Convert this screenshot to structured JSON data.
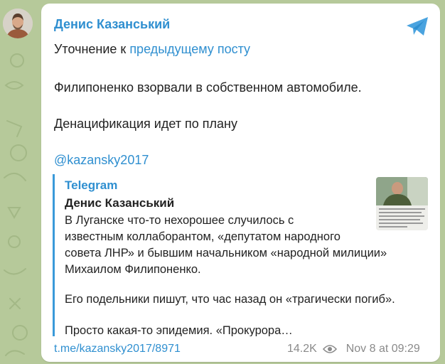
{
  "channel": {
    "author": "Денис Казанський",
    "avatar_icon": "user-photo-avatar",
    "share_icon": "telegram-share-icon"
  },
  "message": {
    "line1_text": "Уточнение к ",
    "line1_link": "предыдущему посту",
    "line2": "Филипоненко взорвали в собственном автомобиле.",
    "line3": "Денацификация идет по плану",
    "mention": "@kazansky2017"
  },
  "quote": {
    "source": "Telegram",
    "author": "Денис Казанський",
    "lines": [
      "В Луганске что-то нехорошее случилось с",
      "известным коллаборантом, «депутатом народного",
      "совета ЛНР» и бывшим начальником «народной милиции»",
      "Михаилом Филипоненко.",
      "Его подельники пишут, что час назад он «трагически погиб».",
      "Просто какая-то эпидемия. «Прокурора…"
    ]
  },
  "footer": {
    "post_link": "t.me/kazansky2017/8971",
    "views": "14.2K",
    "views_icon": "eye-icon",
    "date": "Nov 8 at 09:29"
  },
  "colors": {
    "background": "#b6c99a",
    "accent": "#2f8fd0",
    "text": "#222222",
    "meta": "#8a8a8a"
  }
}
